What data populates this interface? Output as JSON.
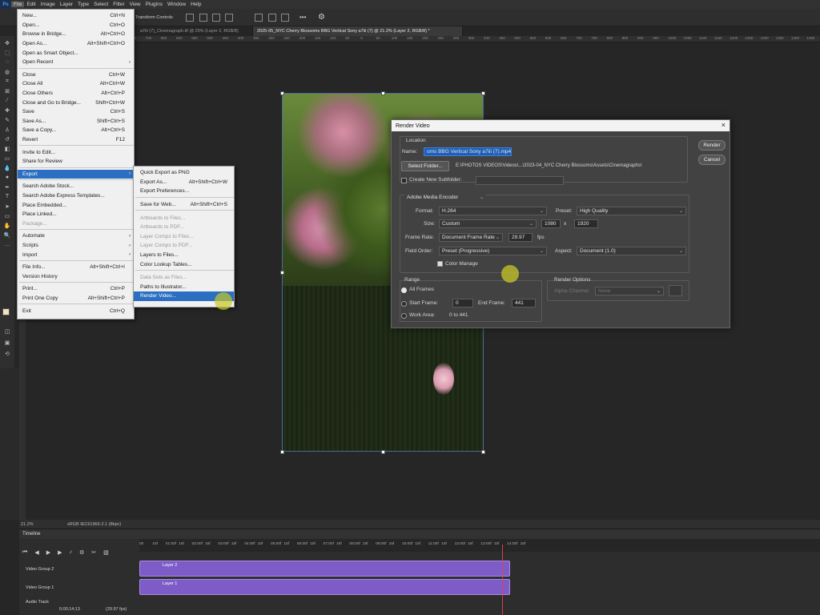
{
  "menubar": {
    "app_badge": "Ps",
    "items": [
      "File",
      "Edit",
      "Image",
      "Layer",
      "Type",
      "Select",
      "Filter",
      "View",
      "Plugins",
      "Window",
      "Help"
    ]
  },
  "options_bar": {
    "transform_controls": "Transform Controls"
  },
  "tabs": [
    {
      "label": "a7iii (7)_Cinemagraph.tif @ 25% (Layer 2, RGB/8)"
    },
    {
      "label": "2025-05_NYC Cherry Blossoms BBG Vertical Sony a7iii (7) @ 21.2% (Layer 2, RGB/8) *"
    }
  ],
  "ruler_ticks": [
    "1100",
    "1050",
    "1000",
    "950",
    "900",
    "850",
    "800",
    "750",
    "700",
    "650",
    "600",
    "550",
    "500",
    "450",
    "400",
    "350",
    "300",
    "250",
    "200",
    "150",
    "100",
    "50",
    "0",
    "50",
    "100",
    "150",
    "200",
    "250",
    "300",
    "350",
    "400",
    "450",
    "500",
    "550",
    "600",
    "650",
    "700",
    "750",
    "800",
    "850",
    "900",
    "950",
    "1000",
    "1050",
    "1100",
    "1150",
    "1200",
    "1250",
    "1300",
    "1350",
    "1400",
    "1450"
  ],
  "file_menu": [
    {
      "label": "New...",
      "shortcut": "Ctrl+N"
    },
    {
      "label": "Open...",
      "shortcut": "Ctrl+O"
    },
    {
      "label": "Browse in Bridge...",
      "shortcut": "Alt+Ctrl+O"
    },
    {
      "label": "Open As...",
      "shortcut": "Alt+Shift+Ctrl+O"
    },
    {
      "label": "Open as Smart Object...",
      "shortcut": ""
    },
    {
      "label": "Open Recent",
      "shortcut": "",
      "arrow": "›"
    },
    {
      "label": "Close",
      "shortcut": "Ctrl+W"
    },
    {
      "label": "Close All",
      "shortcut": "Alt+Ctrl+W"
    },
    {
      "label": "Close Others",
      "shortcut": "Alt+Ctrl+P"
    },
    {
      "label": "Close and Go to Bridge...",
      "shortcut": "Shift+Ctrl+W"
    },
    {
      "label": "Save",
      "shortcut": "Ctrl+S"
    },
    {
      "label": "Save As...",
      "shortcut": "Shift+Ctrl+S"
    },
    {
      "label": "Save a Copy...",
      "shortcut": "Alt+Ctrl+S"
    },
    {
      "label": "Revert",
      "shortcut": "F12"
    },
    {
      "label": "Invite to Edit...",
      "shortcut": ""
    },
    {
      "label": "Share for Review",
      "shortcut": ""
    },
    {
      "label": "Export",
      "shortcut": "",
      "arrow": "›"
    },
    {
      "label": "Search Adobe Stock...",
      "shortcut": ""
    },
    {
      "label": "Search Adobe Express Templates...",
      "shortcut": ""
    },
    {
      "label": "Place Embedded...",
      "shortcut": ""
    },
    {
      "label": "Place Linked...",
      "shortcut": ""
    },
    {
      "label": "Package...",
      "shortcut": ""
    },
    {
      "label": "Automate",
      "shortcut": "",
      "arrow": "›"
    },
    {
      "label": "Scripts",
      "shortcut": "",
      "arrow": "›"
    },
    {
      "label": "Import",
      "shortcut": "",
      "arrow": "›"
    },
    {
      "label": "File Info...",
      "shortcut": "Alt+Shift+Ctrl+I"
    },
    {
      "label": "Version History",
      "shortcut": ""
    },
    {
      "label": "Print...",
      "shortcut": "Ctrl+P"
    },
    {
      "label": "Print One Copy",
      "shortcut": "Alt+Shift+Ctrl+P"
    },
    {
      "label": "Exit",
      "shortcut": "Ctrl+Q"
    }
  ],
  "export_menu": [
    {
      "label": "Quick Export as PNG",
      "shortcut": ""
    },
    {
      "label": "Export As...",
      "shortcut": "Alt+Shift+Ctrl+W"
    },
    {
      "label": "Export Preferences...",
      "shortcut": ""
    },
    {
      "label": "Save for Web...",
      "shortcut": "Alt+Shift+Ctrl+S"
    },
    {
      "label": "Artboards to Files...",
      "shortcut": ""
    },
    {
      "label": "Artboards to PDF...",
      "shortcut": ""
    },
    {
      "label": "Layer Comps to Files...",
      "shortcut": ""
    },
    {
      "label": "Layer Comps to PDF...",
      "shortcut": ""
    },
    {
      "label": "Layers to Files...",
      "shortcut": ""
    },
    {
      "label": "Color Lookup Tables...",
      "shortcut": ""
    },
    {
      "label": "Data Sets as Files...",
      "shortcut": ""
    },
    {
      "label": "Paths to Illustrator...",
      "shortcut": ""
    },
    {
      "label": "Render Video...",
      "shortcut": ""
    }
  ],
  "dialog": {
    "title": "Render Video",
    "location_label": "Location",
    "name_label": "Name:",
    "name_value": "oms BBG Vertical Sony a7iii (7).mp4",
    "select_folder": "Select Folder...",
    "folder_path": "E:\\PHOTOS VIDEOS\\Videos\\...\\2023-04_NYC Cherry Blossoms\\Assets\\Cinemagraphs\\",
    "create_subfolder": "Create New Subfolder:",
    "encoder": "Adobe Media Encoder",
    "format_label": "Format:",
    "format_value": "H.264",
    "preset_label": "Preset:",
    "preset_value": "High Quality",
    "size_label": "Size:",
    "size_value": "Custom",
    "width": "1080",
    "x": "x",
    "height": "1920",
    "frame_rate_label": "Frame Rate:",
    "frame_rate_value": "Document Frame Rate",
    "fps_value": "29.97",
    "fps_unit": "fps",
    "field_order_label": "Field Order:",
    "field_order_value": "Preset (Progressive)",
    "aspect_label": "Aspect:",
    "aspect_value": "Document (1.0)",
    "color_manage": "Color Manage",
    "range_label": "Range",
    "all_frames": "All Frames",
    "start_frame_label": "Start Frame:",
    "start_frame": "0",
    "end_frame_label": "End Frame:",
    "end_frame": "441",
    "work_area_label": "Work Area:",
    "work_area_value": "0 to 441",
    "render_options_label": "Render Options",
    "alpha_label": "Alpha Channel:",
    "alpha_value": "None",
    "render_btn": "Render",
    "cancel_btn": "Cancel"
  },
  "status": {
    "zoom": "21.2%",
    "profile": "sRGB IEC61966-2.1 (8bpc)"
  },
  "timeline": {
    "title": "Timeline",
    "ticks": [
      "00",
      "15f",
      "01:00f",
      "15f",
      "02:00f",
      "15f",
      "03:00f",
      "15f",
      "04:00f",
      "15f",
      "05:00f",
      "15f",
      "06:00f",
      "15f",
      "07:00f",
      "15f",
      "08:00f",
      "15f",
      "09:00f",
      "15f",
      "10:00f",
      "15f",
      "11:00f",
      "15f",
      "12:00f",
      "15f",
      "13:00f",
      "15f",
      "14:00f",
      "15f"
    ],
    "tracks": [
      {
        "group": "Video Group 2",
        "layer": "Layer 2"
      },
      {
        "group": "Video Group 1",
        "layer": "Layer 1"
      }
    ],
    "audio_track": "Audio Track",
    "timecode": "0;00;14;13",
    "fps": "(29.97 fps)"
  },
  "colors": {
    "accent": "#2a6fc1",
    "track": "#7e5cc8",
    "highlight": "#c8c828"
  }
}
